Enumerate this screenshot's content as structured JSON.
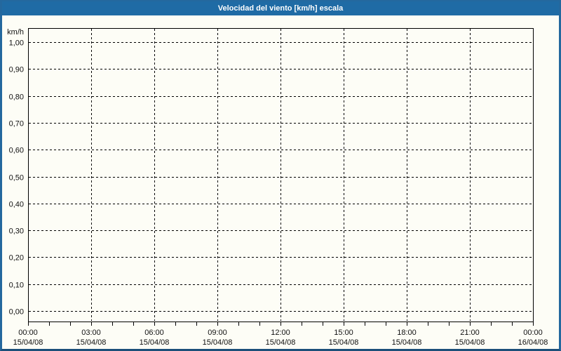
{
  "title": "Velocidad del viento [km/h] escala",
  "colors": {
    "titlebar_bg": "#1f6ba5",
    "titlebar_text": "#ffffff",
    "window_border": "#24689e",
    "background": "#fdfdf6",
    "axis_line": "#000000",
    "grid_line": "#000000",
    "label_text": "#111111"
  },
  "chart_data": {
    "type": "line",
    "title": "Velocidad del viento [km/h] escala",
    "ylabel": "km/h",
    "ylim": [
      0.0,
      1.0
    ],
    "y_tick_step": 0.1,
    "y_tick_labels": [
      "1,00",
      "0,90",
      "0,80",
      "0,70",
      "0,60",
      "0,50",
      "0,40",
      "0,30",
      "0,20",
      "0,10",
      "0,00"
    ],
    "x_axis_kind": "time",
    "x_span_hours": 24,
    "x_major_tick_hours": 3,
    "x_minor_tick_hours": 1,
    "x_tick_labels": [
      {
        "time": "00:00",
        "date": "15/04/08"
      },
      {
        "time": "03:00",
        "date": "15/04/08"
      },
      {
        "time": "06:00",
        "date": "15/04/08"
      },
      {
        "time": "09:00",
        "date": "15/04/08"
      },
      {
        "time": "12:00",
        "date": "15/04/08"
      },
      {
        "time": "15:00",
        "date": "15/04/08"
      },
      {
        "time": "18:00",
        "date": "15/04/08"
      },
      {
        "time": "21:00",
        "date": "15/04/08"
      },
      {
        "time": "00:00",
        "date": "16/04/08"
      }
    ],
    "grid": {
      "style": "dashed",
      "horizontal": true,
      "vertical": true
    },
    "legend": "none",
    "series": []
  }
}
